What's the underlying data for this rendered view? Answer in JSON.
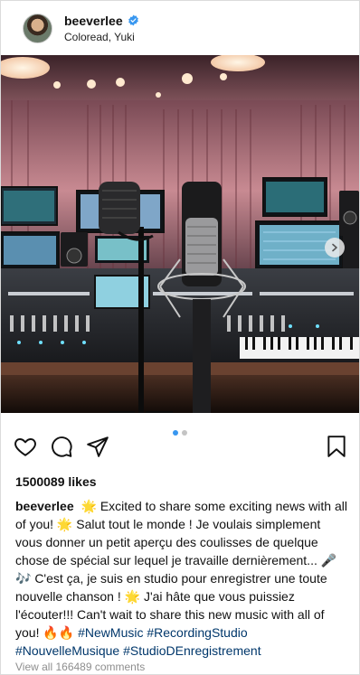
{
  "header": {
    "username": "beeverlee",
    "location": "Coloread, Yuki",
    "verified_color": "#3897f0"
  },
  "post": {
    "image_description_icon": "studio-photo",
    "carousel": {
      "count": 2,
      "active_index": 0
    },
    "likes_text": "1500089 likes"
  },
  "actions": {
    "icons": [
      "heart-icon",
      "comment-icon",
      "share-icon",
      "bookmark-icon"
    ]
  },
  "caption": {
    "username": "beeverlee",
    "text": "🌟 Excited to share some exciting news with all of you! 🌟 Salut tout le monde ! Je voulais simplement vous donner un petit aperçu des coulisses de quelque chose de spécial sur lequel je travaille dernièrement... 🎤🎶 C'est ça, je suis en studio pour enregistrer une toute nouvelle chanson ! 🌟 J'ai hâte que vous puissiez l'écouter!!! Can't wait to share this new music with all of you! 🔥🔥",
    "hashtags": "#NewMusic #RecordingStudio #NouvelleMusique #StudioDEnregistrement"
  },
  "comments": {
    "view_all": "View all 166489 comments"
  },
  "colors": {
    "hashtag": "#00376b",
    "muted": "#8e8e8e",
    "dot_active": "#3897f0",
    "dot_inactive": "#c4c4c4"
  }
}
